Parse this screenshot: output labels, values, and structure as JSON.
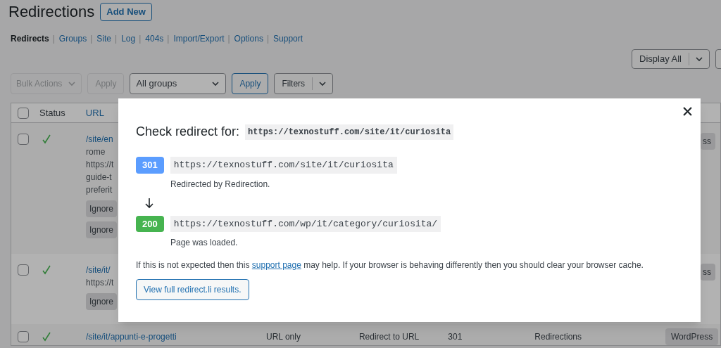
{
  "header": {
    "title": "Redirections",
    "add_new": "Add New"
  },
  "subnav": {
    "separator": "|",
    "items": [
      {
        "label": "Redirects",
        "selected": true
      },
      {
        "label": "Groups",
        "selected": false
      },
      {
        "label": "Site",
        "selected": false
      },
      {
        "label": "Log",
        "selected": false
      },
      {
        "label": "404s",
        "selected": false
      },
      {
        "label": "Import/Export",
        "selected": false
      },
      {
        "label": "Options",
        "selected": false
      },
      {
        "label": "Support",
        "selected": false
      }
    ]
  },
  "toolbar": {
    "bulk_actions": {
      "label": "Bulk Actions",
      "disabled": true
    },
    "apply_bulk": {
      "label": "Apply",
      "disabled": true
    },
    "group_select": "All groups",
    "apply_group": {
      "label": "Apply",
      "disabled": false
    },
    "filters": "Filters",
    "display": "Display All"
  },
  "table": {
    "select_all_checked": false,
    "columns": [
      "Status",
      "URL"
    ],
    "rows": [
      {
        "checked": false,
        "status_ok": true,
        "url_lines": [
          "/site/en",
          "rome",
          "https://t",
          "guide-t",
          "preferit"
        ],
        "buttons": [
          "Ignore",
          "Ignore"
        ],
        "cells": [],
        "badge": "ss"
      },
      {
        "checked": false,
        "status_ok": true,
        "url_lines": [
          "/site/it/",
          "https://t"
        ],
        "buttons": [
          "Ignore"
        ],
        "cells": [],
        "badge": "ss"
      },
      {
        "checked": false,
        "status_ok": true,
        "url_lines": [
          "/site/it/appunti-e-progetti"
        ],
        "buttons": [],
        "cells": [
          "URL only",
          "Redirect to URL",
          "301",
          "Redirections"
        ],
        "badge": "WordPress"
      }
    ]
  },
  "modal": {
    "title": "Check redirect for:",
    "url": "https://texnostuff.com/site/it/curiosita",
    "hops": [
      {
        "code": "301",
        "color": "#5b9dff",
        "url": "https://texnostuff.com/site/it/curiosita",
        "note": "Redirected by Redirection."
      },
      {
        "code": "200",
        "color": "#46b450",
        "url": "https://texnostuff.com/wp/it/category/curiosita/",
        "note": "Page was loaded."
      }
    ],
    "message_before": "If this is not expected then this",
    "link": "support page",
    "message_after": "may help. If your browser is behaving differently then you should clear your browser cache.",
    "button": "View full redirect.li results."
  }
}
